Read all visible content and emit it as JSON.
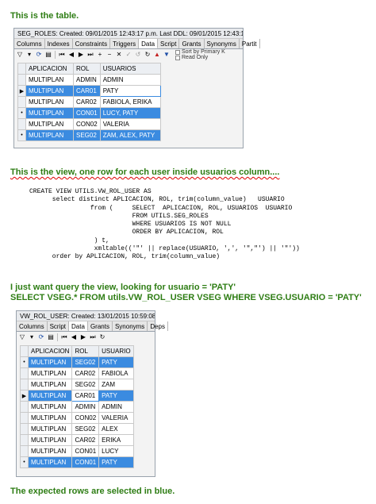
{
  "captions": {
    "table": "This is the table.",
    "view": "This is the view, one row for each user inside usuarios column....",
    "query_intro": "I just want query the view, looking for usuario = 'PATY'",
    "query_sql": "SELECT VSEG.*  FROM utils.VW_ROL_USER  VSEG  WHERE VSEG.USUARIO = 'PATY'",
    "expected": "The expected rows are selected in blue."
  },
  "panel1": {
    "title": "SEG_ROLES:  Created: 09/01/2015 12:43:17 p.m.   Last DDL: 09/01/2015 12:43:17 p.m.",
    "tabs": [
      "Columns",
      "Indexes",
      "Constraints",
      "Triggers",
      "Data",
      "Script",
      "Grants",
      "Synonyms",
      "Partit"
    ],
    "active_tab": "Data",
    "sort_label": "Sort by Primary K",
    "readonly_label": "Read Only",
    "columns": [
      "APLICACION",
      "ROL",
      "USUARIOS"
    ],
    "rows": [
      {
        "marker": "",
        "cells": [
          "MULTIPLAN",
          "ADMIN",
          "ADMIN"
        ],
        "selected": false
      },
      {
        "marker": "▶",
        "cells": [
          "MULTIPLAN",
          "CAR01",
          "PATY"
        ],
        "selected": true,
        "editing": 2
      },
      {
        "marker": "",
        "cells": [
          "MULTIPLAN",
          "CAR02",
          "FABIOLA, ERIKA"
        ],
        "selected": false
      },
      {
        "marker": "•",
        "cells": [
          "MULTIPLAN",
          "CON01",
          "LUCY, PATY"
        ],
        "selected": true
      },
      {
        "marker": "",
        "cells": [
          "MULTIPLAN",
          "CON02",
          "VALERIA"
        ],
        "selected": false
      },
      {
        "marker": "•",
        "cells": [
          "MULTIPLAN",
          "SEG02",
          "ZAM,  ALEX,  PATY"
        ],
        "selected": true
      }
    ]
  },
  "view_sql": [
    "CREATE VIEW UTILS.VW_ROL_USER AS",
    "      select distinct APLICACION, ROL, trim(column_value)   USUARIO",
    "                from (     SELECT  APLICACION, ROL, USUARIOS  USUARIO",
    "                           FROM UTILS.SEG_ROLES",
    "                           WHERE USUARIOS IS NOT NULL",
    "                           ORDER BY APLICACION, ROL",
    "                 ) t,",
    "                 xmltable(('\"' || replace(USUARIO, ',', '\",\"') || '\"'))",
    "      order by APLICACION, ROL, trim(column_value)"
  ],
  "panel2": {
    "title": "VW_ROL_USER:  Created: 13/01/2015 10:59:08 a.m.",
    "tabs": [
      "Columns",
      "Script",
      "Data",
      "Grants",
      "Synonyms",
      "Deps"
    ],
    "active_tab": "Data",
    "columns": [
      "APLICACION",
      "ROL",
      "USUARIO"
    ],
    "rows": [
      {
        "marker": "•",
        "cells": [
          "MULTIPLAN",
          "SEG02",
          "PATY"
        ],
        "selected": true
      },
      {
        "marker": "",
        "cells": [
          "MULTIPLAN",
          "CAR02",
          "FABIOLA"
        ],
        "selected": false
      },
      {
        "marker": "",
        "cells": [
          "MULTIPLAN",
          "SEG02",
          "ZAM"
        ],
        "selected": false
      },
      {
        "marker": "▶",
        "cells": [
          "MULTIPLAN",
          "CAR01",
          "PATY"
        ],
        "selected": true,
        "editing": 1
      },
      {
        "marker": "",
        "cells": [
          "MULTIPLAN",
          "ADMIN",
          "ADMIN"
        ],
        "selected": false
      },
      {
        "marker": "",
        "cells": [
          "MULTIPLAN",
          "CON02",
          "VALERIA"
        ],
        "selected": false
      },
      {
        "marker": "",
        "cells": [
          "MULTIPLAN",
          "SEG02",
          "ALEX"
        ],
        "selected": false
      },
      {
        "marker": "",
        "cells": [
          "MULTIPLAN",
          "CAR02",
          "ERIKA"
        ],
        "selected": false
      },
      {
        "marker": "",
        "cells": [
          "MULTIPLAN",
          "CON01",
          "LUCY"
        ],
        "selected": false
      },
      {
        "marker": "•",
        "cells": [
          "MULTIPLAN",
          "CON01",
          "PATY"
        ],
        "selected": true
      }
    ]
  },
  "colors": {
    "caption_green": "#2e7d14",
    "selection_blue": "#3b8be0"
  }
}
